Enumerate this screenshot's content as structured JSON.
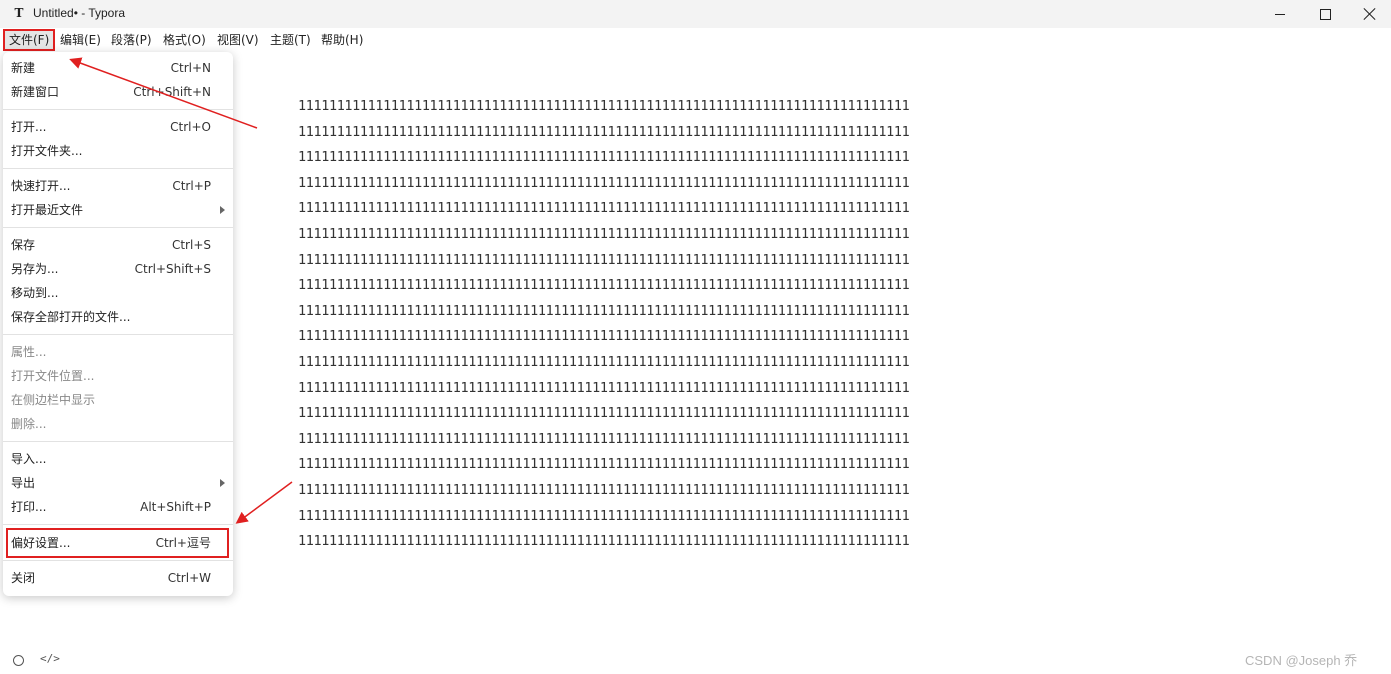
{
  "window": {
    "app_icon": "T",
    "title": "Untitled• - Typora"
  },
  "menubar": [
    {
      "label": "文件(F)"
    },
    {
      "label": "编辑(E)"
    },
    {
      "label": "段落(P)"
    },
    {
      "label": "格式(O)"
    },
    {
      "label": "视图(V)"
    },
    {
      "label": "主题(T)"
    },
    {
      "label": "帮助(H)"
    }
  ],
  "file_menu": {
    "items": [
      {
        "label": "新建",
        "shortcut": "Ctrl+N"
      },
      {
        "label": "新建窗口",
        "shortcut": "Ctrl+Shift+N"
      },
      {
        "label": "打开...",
        "shortcut": "Ctrl+O"
      },
      {
        "label": "打开文件夹...",
        "shortcut": ""
      },
      {
        "label": "快速打开...",
        "shortcut": "Ctrl+P"
      },
      {
        "label": "打开最近文件",
        "shortcut": ""
      },
      {
        "label": "保存",
        "shortcut": "Ctrl+S"
      },
      {
        "label": "另存为...",
        "shortcut": "Ctrl+Shift+S"
      },
      {
        "label": "移动到...",
        "shortcut": ""
      },
      {
        "label": "保存全部打开的文件...",
        "shortcut": ""
      },
      {
        "label": "属性...",
        "shortcut": ""
      },
      {
        "label": "打开文件位置...",
        "shortcut": ""
      },
      {
        "label": "在侧边栏中显示",
        "shortcut": ""
      },
      {
        "label": "删除...",
        "shortcut": ""
      },
      {
        "label": "导入...",
        "shortcut": ""
      },
      {
        "label": "导出",
        "shortcut": ""
      },
      {
        "label": "打印...",
        "shortcut": "Alt+Shift+P"
      },
      {
        "label": "偏好设置...",
        "shortcut": "Ctrl+逗号"
      },
      {
        "label": "关闭",
        "shortcut": "Ctrl+W"
      }
    ]
  },
  "editor": {
    "lines": [
      "1111111111111111111111111111111111111111111111111111111111111111111111111111111",
      "1111111111111111111111111111111111111111111111111111111111111111111111111111111",
      "1111111111111111111111111111111111111111111111111111111111111111111111111111111",
      "1111111111111111111111111111111111111111111111111111111111111111111111111111111",
      "1111111111111111111111111111111111111111111111111111111111111111111111111111111",
      "1111111111111111111111111111111111111111111111111111111111111111111111111111111",
      "1111111111111111111111111111111111111111111111111111111111111111111111111111111",
      "1111111111111111111111111111111111111111111111111111111111111111111111111111111",
      "1111111111111111111111111111111111111111111111111111111111111111111111111111111",
      "1111111111111111111111111111111111111111111111111111111111111111111111111111111",
      "1111111111111111111111111111111111111111111111111111111111111111111111111111111",
      "1111111111111111111111111111111111111111111111111111111111111111111111111111111",
      "1111111111111111111111111111111111111111111111111111111111111111111111111111111",
      "1111111111111111111111111111111111111111111111111111111111111111111111111111111",
      "1111111111111111111111111111111111111111111111111111111111111111111111111111111",
      "1111111111111111111111111111111111111111111111111111111111111111111111111111111",
      "1111111111111111111111111111111111111111111111111111111111111111111111111111111",
      "1111111111111111111111111111111111111111111111111111111111111111111111111111111"
    ]
  },
  "statusbar": {
    "code_toggle": "</>",
    "watermark": "CSDN @Joseph 乔"
  },
  "colors": {
    "highlight": "#e02020",
    "menu_hover": "#e5e5e5"
  }
}
